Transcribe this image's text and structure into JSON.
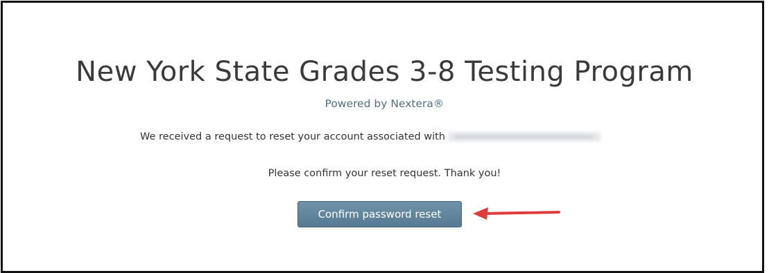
{
  "header": {
    "title": "New York State Grades 3-8 Testing Program",
    "powered_by": "Powered by Nextera®"
  },
  "message": {
    "request_text": "We received a request to reset your account associated with",
    "email_redacted": "",
    "confirm_text": "Please confirm your reset request. Thank you!"
  },
  "actions": {
    "confirm_label": "Confirm password reset"
  },
  "annotation": {
    "arrow_icon": "left-arrow-icon",
    "arrow_color": "#e03c3c"
  },
  "colors": {
    "title": "#3a3a3a",
    "powered_by": "#4e7186",
    "button": "#5f84a0"
  }
}
